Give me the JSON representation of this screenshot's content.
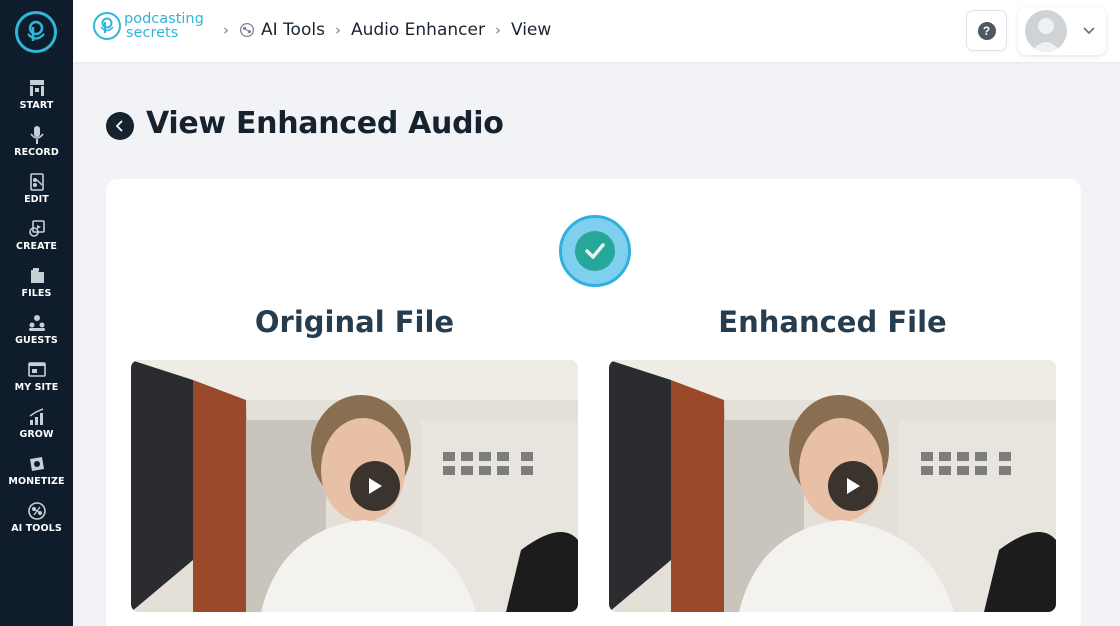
{
  "sidebar": {
    "items": [
      {
        "label": "START",
        "icon": "start-icon"
      },
      {
        "label": "RECORD",
        "icon": "microphone-icon"
      },
      {
        "label": "EDIT",
        "icon": "edit-icon"
      },
      {
        "label": "CREATE",
        "icon": "create-icon"
      },
      {
        "label": "FILES",
        "icon": "files-icon"
      },
      {
        "label": "GUESTS",
        "icon": "guests-icon"
      },
      {
        "label": "MY SITE",
        "icon": "my-site-icon"
      },
      {
        "label": "GROW",
        "icon": "grow-icon"
      },
      {
        "label": "MONETIZE",
        "icon": "monetize-icon"
      },
      {
        "label": "AI TOOLS",
        "icon": "ai-tools-icon"
      }
    ]
  },
  "header": {
    "brand_line1": "podcasting",
    "brand_line2": "secrets",
    "breadcrumbs": [
      "AI Tools",
      "Audio Enhancer",
      "View"
    ],
    "help_label": "?"
  },
  "main": {
    "title": "View Enhanced Audio",
    "original_title": "Original File",
    "enhanced_title": "Enhanced File"
  },
  "colors": {
    "sidebar_bg": "#0f1c2b",
    "accent": "#2fb6d8",
    "success": "#27a79a"
  }
}
